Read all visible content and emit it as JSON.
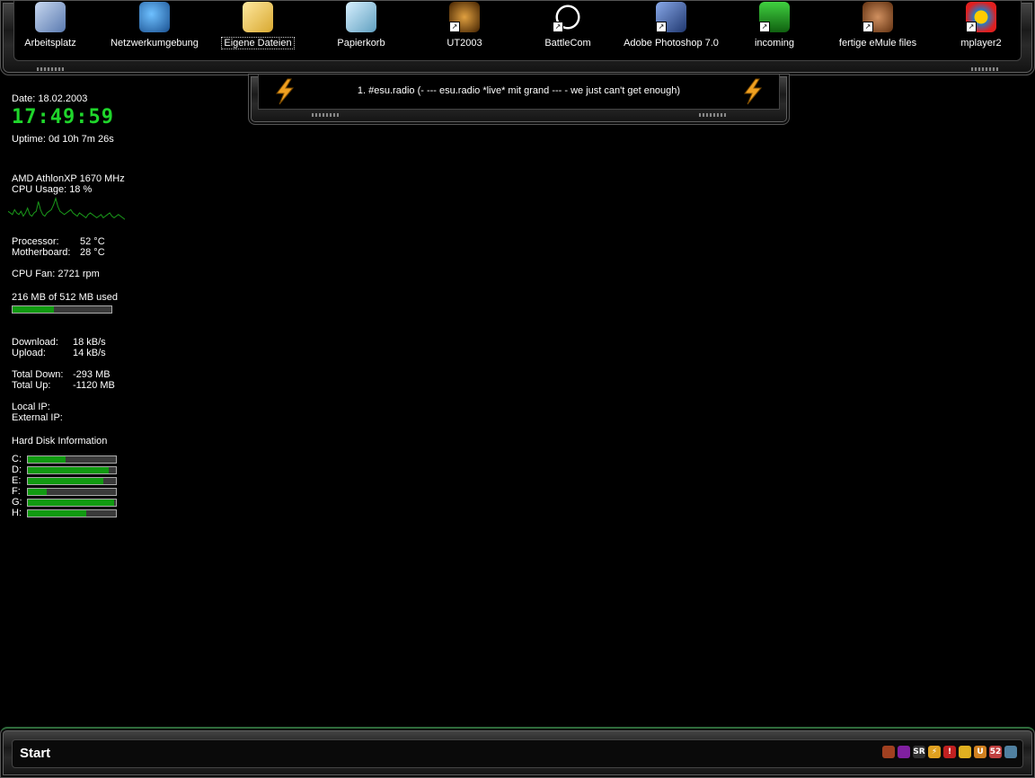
{
  "desktop_icons": [
    {
      "label": "Arbeitsplatz",
      "icon": "my-computer-icon"
    },
    {
      "label": "Netzwerkumgebung",
      "icon": "network-places-icon"
    },
    {
      "label": "Eigene Dateien",
      "icon": "my-documents-icon",
      "selected": true
    },
    {
      "label": "Papierkorb",
      "icon": "recycle-bin-icon"
    },
    {
      "label": "UT2003",
      "icon": "ut2003-icon",
      "shortcut": true
    },
    {
      "label": "BattleCom",
      "icon": "battlecom-icon",
      "shortcut": true
    },
    {
      "label": "Adobe Photoshop 7.0",
      "icon": "photoshop-icon",
      "shortcut": true
    },
    {
      "label": "incoming",
      "icon": "incoming-folder-icon",
      "shortcut": true
    },
    {
      "label": "fertige eMule files",
      "icon": "emule-icon",
      "shortcut": true
    },
    {
      "label": "mplayer2",
      "icon": "media-player-icon",
      "shortcut": true
    }
  ],
  "radio": {
    "text": "1. #esu.radio (- --- esu.radio *live* mit grand --- - we just can't get enough)"
  },
  "sysinfo": {
    "date": "Date: 18.02.2003",
    "clock": "17:49:59",
    "uptime": "Uptime: 0d 10h 7m 26s",
    "cpu_name": "AMD AthlonXP 1670 MHz",
    "cpu_usage": "CPU Usage: 18 %",
    "cpu_graph": [
      6,
      5,
      4,
      7,
      5,
      4,
      6,
      3,
      5,
      8,
      4,
      3,
      5,
      6,
      12,
      7,
      4,
      3,
      5,
      6,
      7,
      10,
      14,
      9,
      6,
      5,
      4,
      5,
      6,
      7,
      5,
      4,
      3,
      5,
      4,
      3,
      2,
      4,
      5,
      4,
      3,
      2,
      3,
      4,
      2,
      3,
      4,
      5,
      3,
      2,
      3,
      4,
      3,
      2,
      1
    ],
    "temp_processor_label": "Processor:",
    "temp_processor_value": "52 °C",
    "temp_motherboard_label": "Motherboard:",
    "temp_motherboard_value": "28 °C",
    "cpu_fan": "CPU Fan: 2721 rpm",
    "memory": "216 MB of 512 MB used",
    "memory_fraction": 0.42,
    "download_label": "Download:",
    "download_value": "18 kB/s",
    "upload_label": "Upload:",
    "upload_value": "14 kB/s",
    "total_down_label": "Total Down:",
    "total_down_value": "-293 MB",
    "total_up_label": "Total Up:",
    "total_up_value": "-1120 MB",
    "local_ip": "Local IP:",
    "external_ip": "External IP:",
    "hdd_title": "Hard Disk Information",
    "drives": [
      {
        "label": "C:",
        "fraction": 0.43
      },
      {
        "label": "D:",
        "fraction": 0.92
      },
      {
        "label": "E:",
        "fraction": 0.86
      },
      {
        "label": "F:",
        "fraction": 0.21
      },
      {
        "label": "G:",
        "fraction": 0.98
      },
      {
        "label": "H:",
        "fraction": 0.66
      }
    ]
  },
  "taskbar": {
    "start_label": "Start"
  },
  "tray_icons": [
    "emule-tray-icon",
    "teamspeak-tray-icon",
    "sr-tray-icon",
    "winamp-tray-icon",
    "hardware-monitor-tray-icon",
    "folder-tray-icon",
    "ut-tray-icon",
    "sound-tray-icon",
    "network-tray-icon"
  ],
  "colors": {
    "accent_green": "#1fd62b",
    "bar_fill": "#119a11"
  }
}
